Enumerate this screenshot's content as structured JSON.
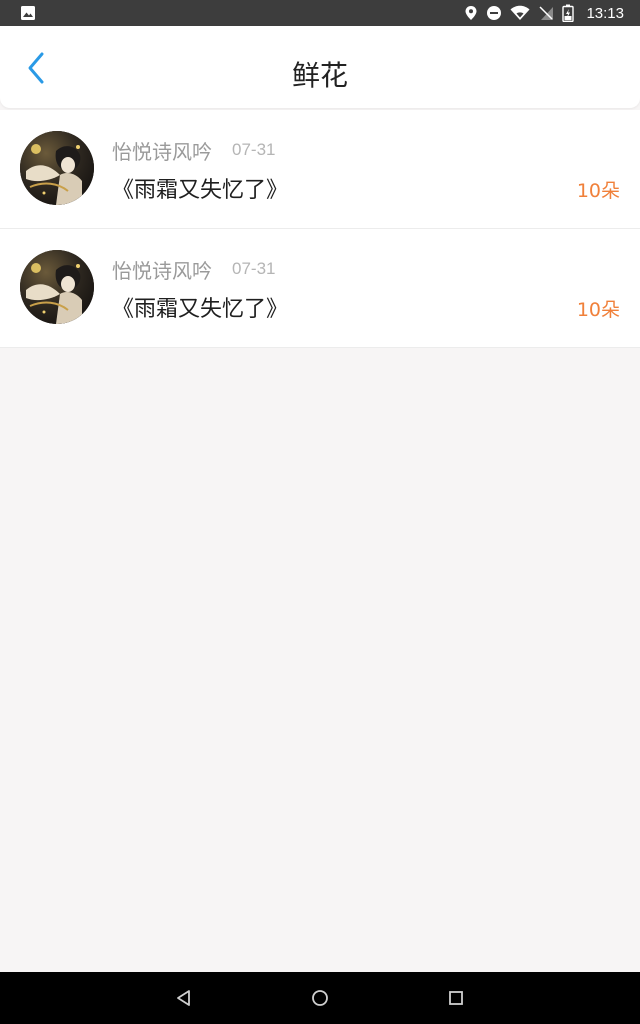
{
  "status_bar": {
    "time": "13:13",
    "icons": [
      "image-icon",
      "location-icon",
      "dnd-icon",
      "wifi-icon",
      "no-sim-icon",
      "battery-charging-icon"
    ]
  },
  "header": {
    "title": "鲜花",
    "back_icon": "chevron-left-icon"
  },
  "list": [
    {
      "user": "怡悦诗风吟",
      "date": "07-31",
      "work": "《雨霜又失忆了》",
      "count": "10朵"
    },
    {
      "user": "怡悦诗风吟",
      "date": "07-31",
      "work": "《雨霜又失忆了》",
      "count": "10朵"
    }
  ],
  "nav": {
    "icons": [
      "back-triangle-icon",
      "home-circle-icon",
      "recents-square-icon"
    ]
  },
  "colors": {
    "accent_blue": "#2a9ae6",
    "count_orange": "#f0803a",
    "status_bar": "#3d3d3d",
    "background": "#f7f5f5"
  }
}
